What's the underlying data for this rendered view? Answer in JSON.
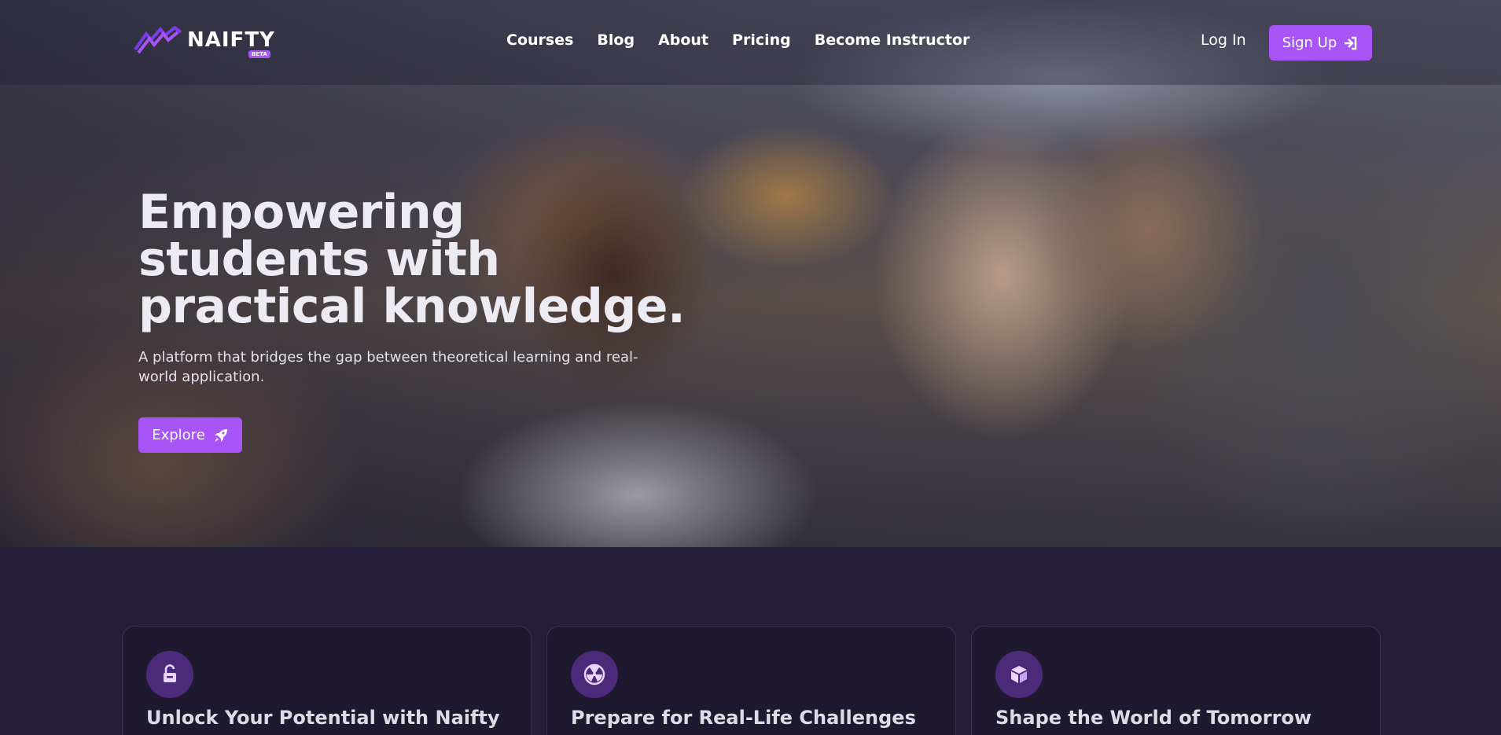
{
  "brand": {
    "name": "NAIFTY",
    "badge": "BETA",
    "accent": "#a855f7"
  },
  "nav": {
    "links": [
      "Courses",
      "Blog",
      "About",
      "Pricing",
      "Become Instructor"
    ],
    "login_label": "Log In",
    "signup_label": "Sign Up"
  },
  "hero": {
    "title": "Empowering students with practical knowledge.",
    "subtitle": "A platform that bridges the gap between theoretical learning and real-world application.",
    "cta_label": "Explore"
  },
  "features": [
    {
      "icon": "unlock-icon",
      "title": "Unlock Your Potential with Naifty"
    },
    {
      "icon": "radiation-icon",
      "title": "Prepare for Real-Life Challenges"
    },
    {
      "icon": "cube-icon",
      "title": "Shape the World of Tomorrow"
    }
  ]
}
